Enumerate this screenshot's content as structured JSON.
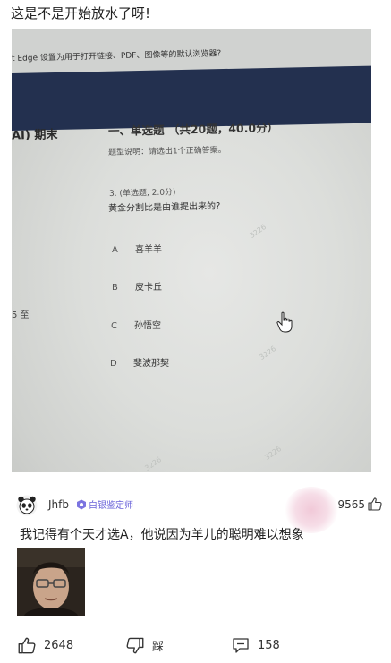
{
  "post": {
    "title": "这是不是开始放水了呀!"
  },
  "photo": {
    "edge_text": "t Edge 设置为用于打开链接、PDF、图像等的默认浏览器?",
    "sidebar_title": "AI) 期末",
    "sidebar_num": "5 至",
    "section_title": "一、单选题 （共20题，40.0分）",
    "section_desc": "题型说明：请选出1个正确答案。",
    "question_meta": "3. (单选题, 2.0分)",
    "question_text": "黄金分割比是由谁提出来的?",
    "options": [
      {
        "letter": "A",
        "text": "喜羊羊"
      },
      {
        "letter": "B",
        "text": "皮卡丘"
      },
      {
        "letter": "C",
        "text": "孙悟空"
      },
      {
        "letter": "D",
        "text": "斐波那契"
      }
    ],
    "watermarks": [
      "3226",
      "3226",
      "3226",
      "3226"
    ]
  },
  "comment": {
    "username": "Jhfb",
    "badge": "白银鉴定师",
    "likes": "9565",
    "text": "我记得有个天才选A，他说因为羊儿的聪明难以想象"
  },
  "bottom_bar": {
    "like_count": "2648",
    "dislike_label": "踩",
    "comment_count": "158"
  },
  "colors": {
    "navbar": "#23304f",
    "badge": "#6a63d9",
    "text": "#222222"
  },
  "icons": [
    "panda-avatar-icon",
    "silver-badge-icon",
    "thumbs-up-icon",
    "thumbs-down-icon",
    "comment-icon",
    "cursor-hand-icon"
  ]
}
